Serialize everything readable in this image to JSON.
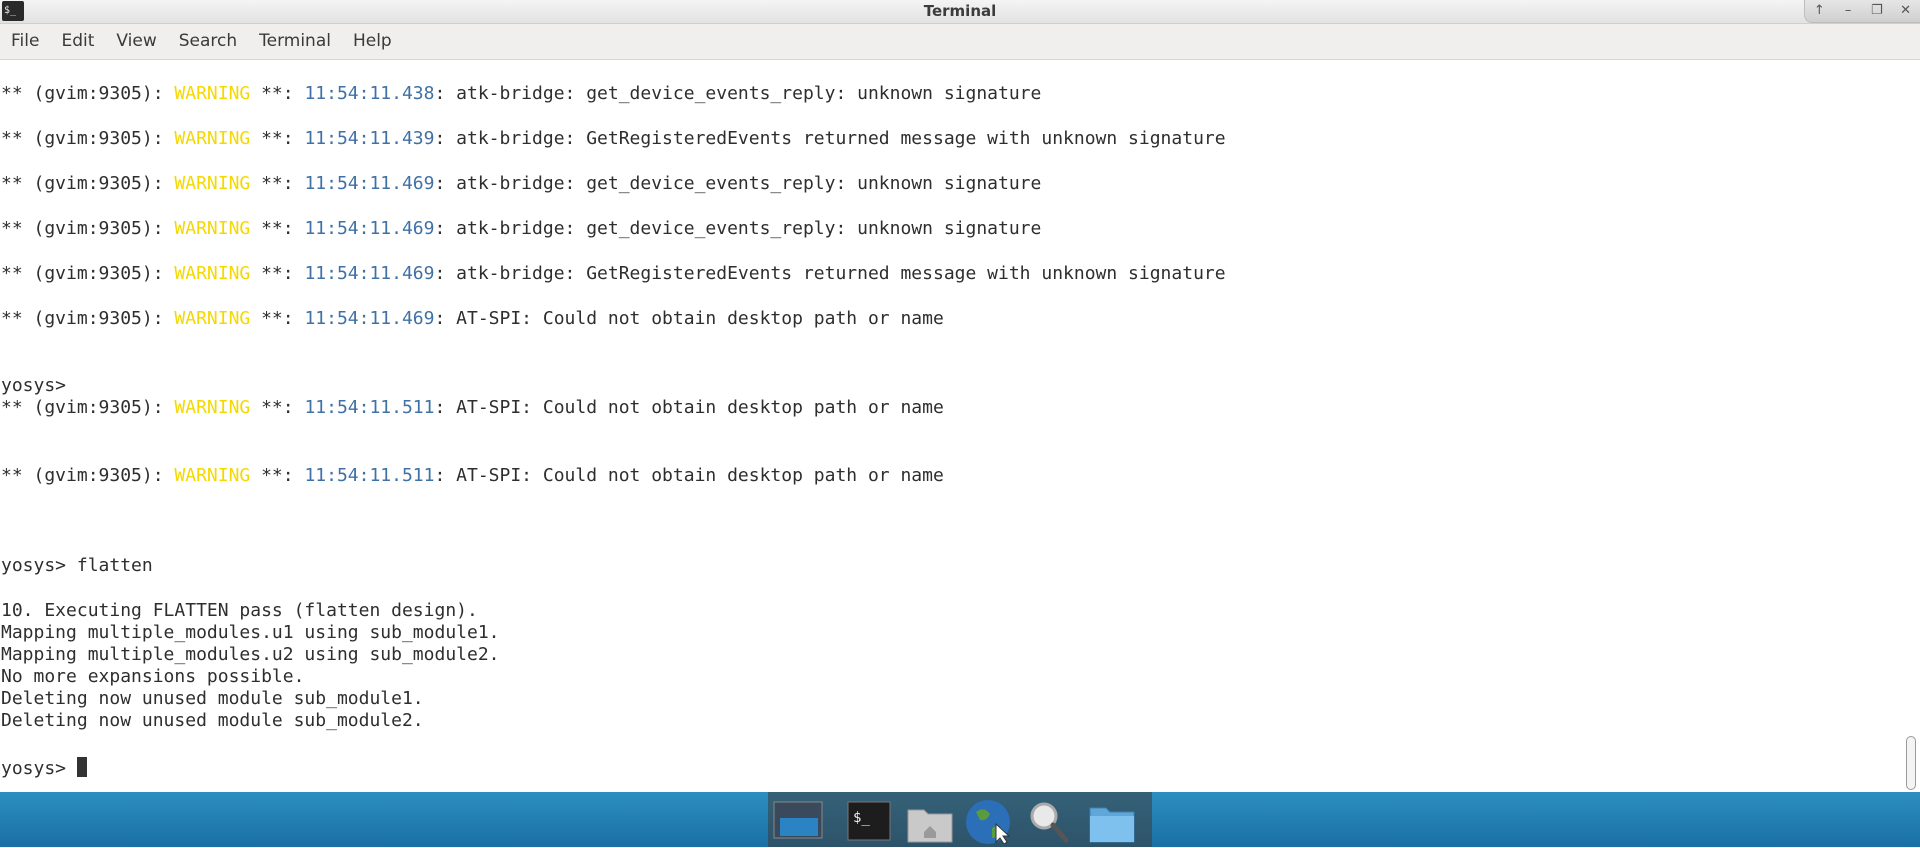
{
  "window": {
    "title": "Terminal",
    "app_icon_glyph": "$_",
    "controls": {
      "up": "↑",
      "minimize": "–",
      "restore": "❐",
      "close": "✕"
    }
  },
  "menu": [
    "File",
    "Edit",
    "View",
    "Search",
    "Terminal",
    "Help"
  ],
  "terminal": {
    "log": [
      {
        "prefix": "** (gvim:9305): ",
        "level": "WARNING",
        "mid": " **: ",
        "time": "11:54:11.438",
        "msg": ": atk-bridge: get_device_events_reply: unknown signature"
      },
      {
        "prefix": "** (gvim:9305): ",
        "level": "WARNING",
        "mid": " **: ",
        "time": "11:54:11.439",
        "msg": ": atk-bridge: GetRegisteredEvents returned message with unknown signature"
      },
      {
        "prefix": "** (gvim:9305): ",
        "level": "WARNING",
        "mid": " **: ",
        "time": "11:54:11.469",
        "msg": ": atk-bridge: get_device_events_reply: unknown signature"
      },
      {
        "prefix": "** (gvim:9305): ",
        "level": "WARNING",
        "mid": " **: ",
        "time": "11:54:11.469",
        "msg": ": atk-bridge: get_device_events_reply: unknown signature"
      },
      {
        "prefix": "** (gvim:9305): ",
        "level": "WARNING",
        "mid": " **: ",
        "time": "11:54:11.469",
        "msg": ": atk-bridge: GetRegisteredEvents returned message with unknown signature"
      },
      {
        "prefix": "** (gvim:9305): ",
        "level": "WARNING",
        "mid": " **: ",
        "time": "11:54:11.469",
        "msg": ": AT-SPI: Could not obtain desktop path or name"
      }
    ],
    "prompt1": "yosys>",
    "log2": [
      {
        "prefix": "** (gvim:9305): ",
        "level": "WARNING",
        "mid": " **: ",
        "time": "11:54:11.511",
        "msg": ": AT-SPI: Could not obtain desktop path or name"
      },
      {
        "prefix": "** (gvim:9305): ",
        "level": "WARNING",
        "mid": " **: ",
        "time": "11:54:11.511",
        "msg": ": AT-SPI: Could not obtain desktop path or name"
      }
    ],
    "command": "yosys> flatten",
    "output": [
      "10. Executing FLATTEN pass (flatten design).",
      "Mapping multiple_modules.u1 using sub_module1.",
      "Mapping multiple_modules.u2 using sub_module2.",
      "No more expansions possible.",
      "Deleting now unused module sub_module1.",
      "Deleting now unused module sub_module2."
    ],
    "prompt_final": "yosys> "
  },
  "dock": [
    "desktop-icon",
    "terminal-icon",
    "home-folder-icon",
    "web-browser-icon",
    "search-icon",
    "folder-icon"
  ],
  "colors": {
    "warning": "#f5d800",
    "timestamp": "#3f70a6",
    "taskbar": "#1f7bb0"
  }
}
